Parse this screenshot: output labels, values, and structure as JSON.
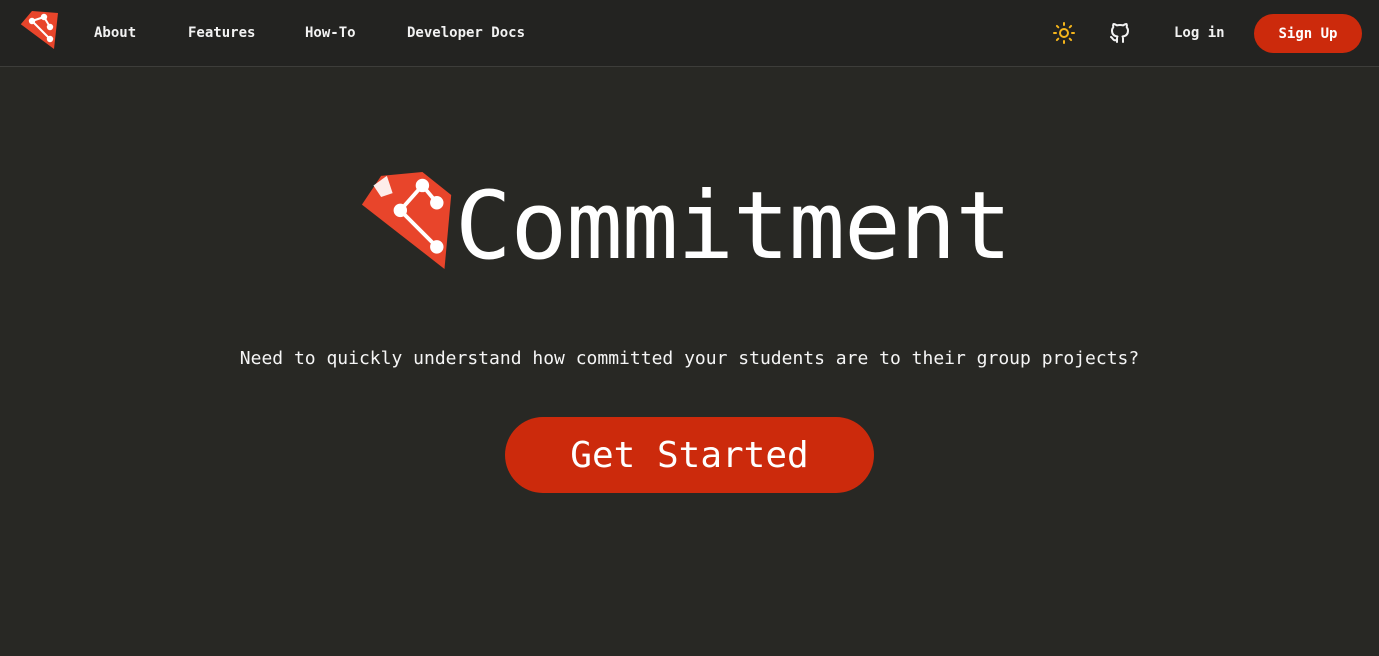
{
  "nav": {
    "logo_icon": "commitment-logo-icon",
    "links": {
      "about": "About",
      "features": "Features",
      "howto": "How-To",
      "docs": "Developer Docs"
    },
    "theme_icon": "sun-icon",
    "github_icon": "github-icon",
    "login_label": "Log in",
    "signup_label": "Sign Up"
  },
  "hero": {
    "logo_icon": "commitment-logo-icon",
    "title": "Commitment",
    "tagline": "Need to quickly understand how committed your students are to their group projects?",
    "cta_label": "Get Started"
  },
  "colors": {
    "background": "#282824",
    "navbar": "#232321",
    "accent": "#cc2a0c",
    "logo": "#e8452b",
    "sun": "#f5b51b"
  }
}
